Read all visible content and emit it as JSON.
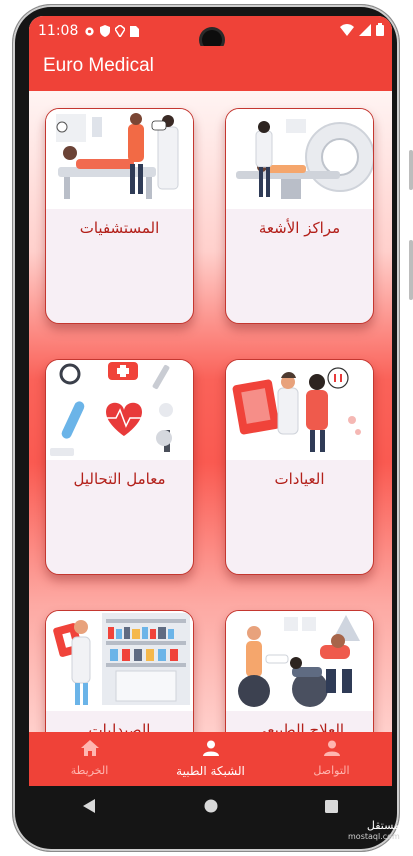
{
  "status_bar": {
    "time": "11:08",
    "left_icons": [
      "gear-icon",
      "shield-icon",
      "vpn-icon",
      "sim-icon"
    ],
    "right_icons": [
      "wifi-icon",
      "signal-icon",
      "battery-icon"
    ]
  },
  "app_bar": {
    "title": "Euro Medical"
  },
  "colors": {
    "primary": "#ef4238",
    "card_border": "#c43730",
    "card_label": "#b3201a",
    "card_bg": "#f7eff5"
  },
  "cards": [
    {
      "label": "المستشفيات",
      "image": "hospital-illustration"
    },
    {
      "label": "مراكز الأشعة",
      "image": "xray-center-illustration"
    },
    {
      "label": "معامل التحاليل",
      "image": "lab-tests-illustration"
    },
    {
      "label": "العيادات",
      "image": "clinics-illustration"
    },
    {
      "label": "الصيدليات",
      "image": "pharmacy-illustration"
    },
    {
      "label": "العلاج الطبيعي",
      "image": "physiotherapy-illustration"
    }
  ],
  "bottom_nav": {
    "items": [
      {
        "label": "الخريطة",
        "icon": "home-icon",
        "active": false
      },
      {
        "label": "الشبكة الطبية",
        "icon": "person-icon",
        "active": true
      },
      {
        "label": "التواصل",
        "icon": "person-icon",
        "active": false
      }
    ]
  },
  "watermark": {
    "text": "مستقل",
    "sub": "mostaql.com"
  }
}
